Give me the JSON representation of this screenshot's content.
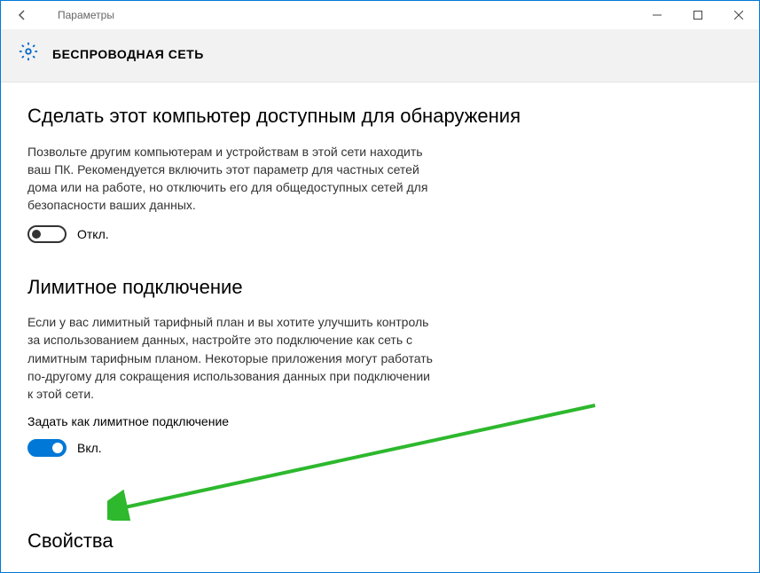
{
  "titlebar": {
    "title": "Параметры"
  },
  "header": {
    "title": "БЕСПРОВОДНАЯ СЕТЬ"
  },
  "sections": {
    "discovery": {
      "title": "Сделать этот компьютер доступным для обнаружения",
      "description": "Позвольте другим компьютерам и устройствам в этой сети находить ваш ПК. Рекомендуется включить этот параметр для частных сетей дома или на работе, но отключить его для общедоступных сетей для безопасности ваших данных.",
      "toggle_state": "Откл."
    },
    "metered": {
      "title": "Лимитное подключение",
      "description": "Если у вас лимитный тарифный план и вы хотите улучшить контроль за использованием данных, настройте это подключение как сеть с лимитным тарифным планом. Некоторые приложения могут работать по-другому для сокращения использования данных при подключении к этой сети.",
      "sublabel": "Задать как лимитное подключение",
      "toggle_state": "Вкл."
    },
    "properties": {
      "title": "Свойства"
    }
  }
}
